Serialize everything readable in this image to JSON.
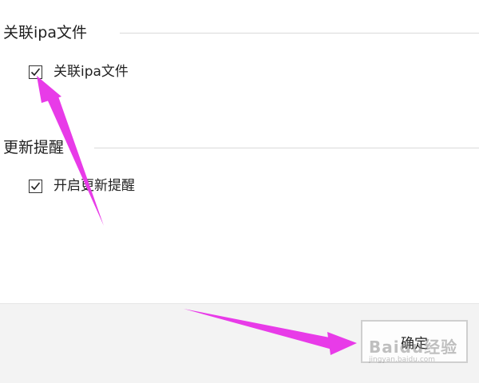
{
  "sections": [
    {
      "title": "关联ipa文件",
      "checkbox": {
        "label": "关联ipa文件",
        "checked": true
      }
    },
    {
      "title": "更新提醒",
      "checkbox": {
        "label": "开启更新提醒",
        "checked": true
      }
    }
  ],
  "footer": {
    "ok_label": "确定"
  },
  "annotation_color": "#e83be8",
  "watermark": {
    "logo": "Baidu经验",
    "url": "jingyan.baidu.com"
  }
}
